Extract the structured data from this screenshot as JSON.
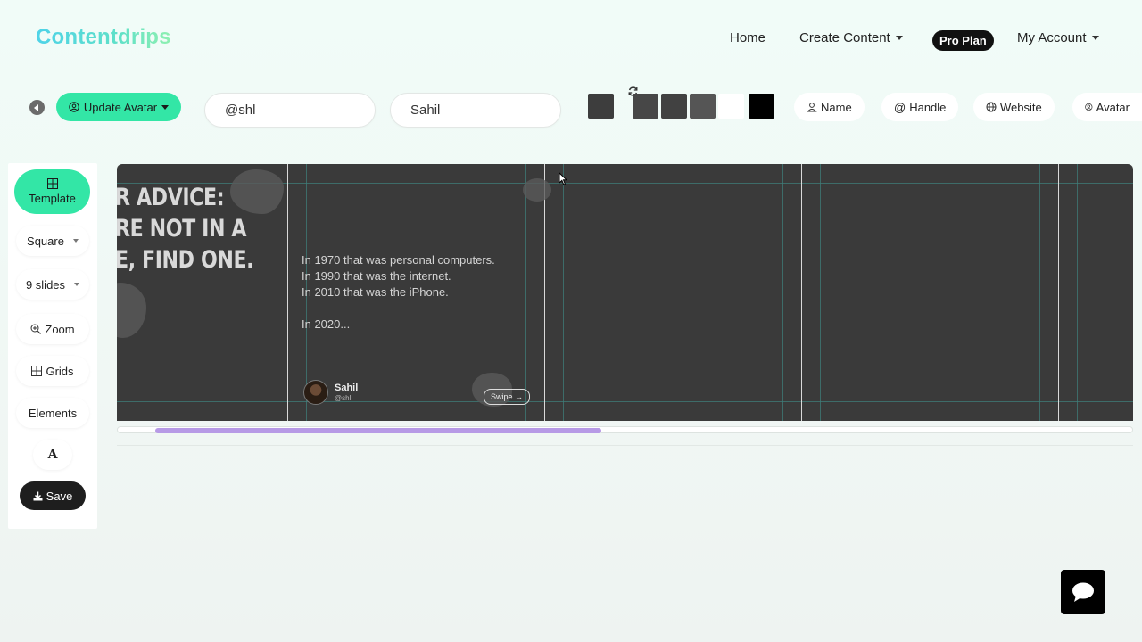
{
  "brand": {
    "logo": "Contentdrips"
  },
  "nav": {
    "home": "Home",
    "create_content": "Create Content",
    "plan_badge": "Pro Plan",
    "my_account": "My Account"
  },
  "toolbar": {
    "update_avatar": "Update Avatar",
    "handle_value": "@shl",
    "name_value": "Sahil",
    "swatch_colors": [
      "#3d3d3d",
      "#474747",
      "#414141",
      "#555555",
      "#ffffff",
      "#000000"
    ],
    "field_buttons": [
      "Name",
      "Handle",
      "Website",
      "Avatar"
    ]
  },
  "sidebar": {
    "template": "Template",
    "size": "Square",
    "slides": "9 slides",
    "zoom": "Zoom",
    "grids": "Grids",
    "elements": "Elements",
    "font": "A",
    "save": "Save"
  },
  "canvas": {
    "slide1_headline": [
      "R ADVICE:",
      "RE NOT IN A",
      "E, FIND ONE."
    ],
    "slide2_lines": [
      "In 1970 that was personal computers.",
      "In 1990 that was the internet.",
      "In 2010 that was the iPhone.",
      "In 2020..."
    ],
    "author_name": "Sahil",
    "author_handle": "@shl",
    "swipe": "Swipe →"
  },
  "colors": {
    "accent": "#33e6a6",
    "canvas_bg": "#3a3a3a",
    "scroll_thumb": "#b79ae6"
  }
}
